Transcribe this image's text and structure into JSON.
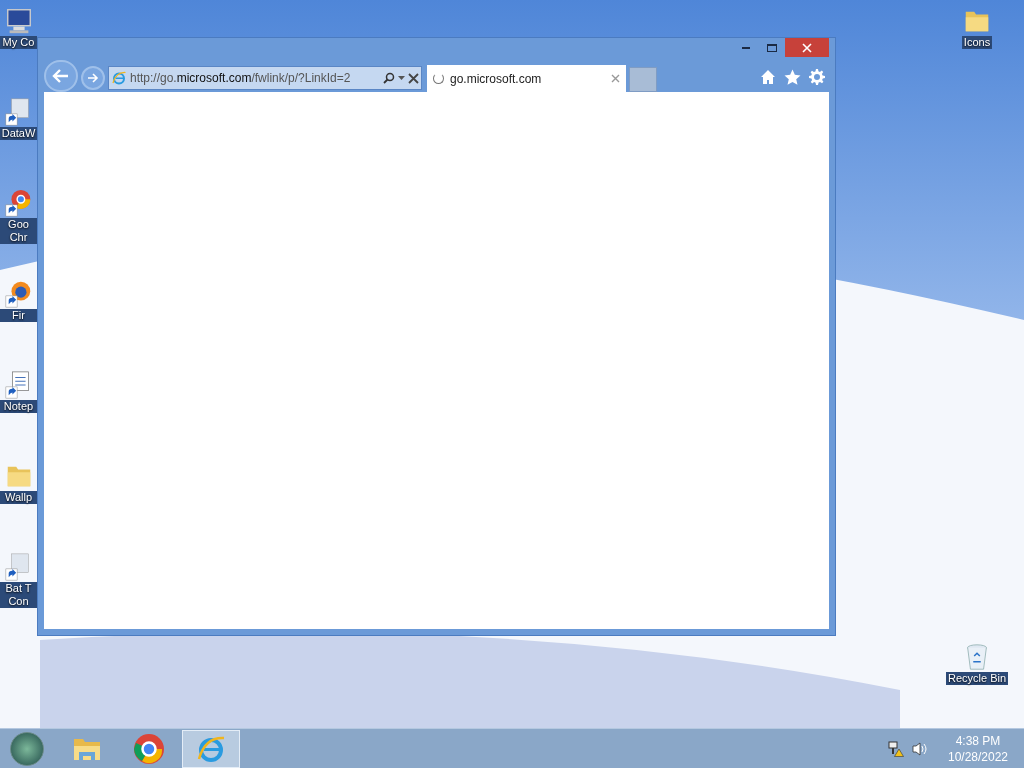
{
  "desktop_left": [
    {
      "label": "My Co",
      "kind": "computer"
    },
    {
      "label": "DataW",
      "kind": "shortcut"
    },
    {
      "label": "Goo Chr",
      "kind": "chrome"
    },
    {
      "label": "Fir",
      "kind": "firefox"
    },
    {
      "label": "Notep",
      "kind": "notepad"
    },
    {
      "label": "Wallp",
      "kind": "folder"
    },
    {
      "label": "Bat T Con",
      "kind": "shortcut"
    }
  ],
  "desktop_right": [
    {
      "label": "Icons",
      "kind": "folder"
    },
    {
      "label": "Recycle Bin",
      "kind": "recycle"
    }
  ],
  "browser": {
    "address": "http://go.**microsoft.com**/fwlink/p/?LinkId=2",
    "tabs": [
      {
        "label": "go.microsoft.com",
        "selected": true,
        "loading": true
      }
    ]
  },
  "taskbar": {
    "apps": [
      {
        "kind": "explorer",
        "selected": false
      },
      {
        "kind": "chrome",
        "selected": false
      },
      {
        "kind": "ie",
        "selected": true
      }
    ],
    "time": "4:38 PM",
    "date": "10/28/2022"
  }
}
